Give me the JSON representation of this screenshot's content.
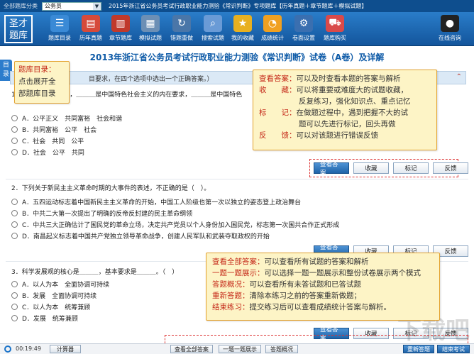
{
  "topbar": {
    "bank_label": "全部题库分类",
    "bank_value": "公务员",
    "title": "2015年浙江省公务员考试行政职业能力测验《常识判断》专项题库【历年真题＋章节题库＋模拟试题】"
  },
  "logo": {
    "line1": "圣才",
    "line2": "题库"
  },
  "toolbar": [
    {
      "label": "题库目录",
      "icon": "list-icon",
      "color": "#3a8ad6"
    },
    {
      "label": "历年真题",
      "icon": "book-icon",
      "color": "#d64a3a"
    },
    {
      "label": "章节题库",
      "icon": "book-stack-icon",
      "color": "#c0392b"
    },
    {
      "label": "模拟试题",
      "icon": "document-icon",
      "color": "#6c8fb5"
    },
    {
      "label": "错题重做",
      "icon": "redo-icon",
      "color": "#4a76a8"
    },
    {
      "label": "搜索试题",
      "icon": "search-icon",
      "color": "#6a9bd6"
    },
    {
      "label": "我的收藏",
      "icon": "star-icon",
      "color": "#e8b020"
    },
    {
      "label": "成绩统计",
      "icon": "chart-icon",
      "color": "#f0a020"
    },
    {
      "label": "卷面设置",
      "icon": "gear-icon",
      "color": "#3a6fb0"
    },
    {
      "label": "题库购买",
      "icon": "cart-icon",
      "color": "#d94a4a"
    },
    {
      "label": "在线咨询",
      "icon": "qq-icon",
      "color": "#222222"
    }
  ],
  "page_title": "2013年浙江省公务员考试行政职业能力测验《常识判断》试卷（A卷）及详解",
  "dir_tab": "目录",
  "instruction": "目要求，在四个选项中选出一个正确答案。）",
  "questions": [
    {
      "stem": "1．　　　　　　　出，＿＿＿是中国特色社会主义的内在要求，＿＿＿是中国特色",
      "options": [
        "A．公平正义　共同富裕　社会和谐",
        "B．共同富裕　公平　社会",
        "C．社会　共同　公平",
        "D．社会　公平　共同"
      ]
    },
    {
      "stem": "2．下列关于新民主主义革命时期的大事件的表述，不正确的是（　）。",
      "options": [
        "A．五四运动标志着中国新民主主义革命的开始，中国工人阶级也第一次以独立的姿态登上政治舞台",
        "B．中共二大第一次提出了明确的反帝反封建的民主革命纲领",
        "C．中共三大正确估计了国民党的革命立场，决定共产党员以个人身份加入国民党，标志第一次国共合作正式形成",
        "D．南昌起义标志着中国共产党独立领导革命战争，创建人民军队和武装夺取政权的开始"
      ]
    },
    {
      "stem": "3．科学发展观的核心是＿＿＿，基本要求是＿＿＿。（　）",
      "options": [
        "A．以人为本　全面协调可持续",
        "B．发展　全面协调可持续",
        "C．以人为本　统筹兼顾",
        "D．发展　统筹兼顾"
      ]
    }
  ],
  "question_buttons": [
    "查看答案",
    "收藏",
    "标记",
    "反馈"
  ],
  "callouts": {
    "catalog": [
      "题库目录：",
      "点击展开全",
      "部题库目录"
    ],
    "question_tools": [
      {
        "key": "查看答案：",
        "text": "可以及时查看本题的答案与解析"
      },
      {
        "key": "收　　藏：",
        "text": "可以将重要或难度大的试题收藏，"
      },
      {
        "key": "",
        "text": "反复练习，强化知识点、重点记忆"
      },
      {
        "key": "标　　记：",
        "text": "在做题过程中，遇到把握不大的试"
      },
      {
        "key": "",
        "text": "题可以先进行标记，回头再做"
      },
      {
        "key": "反　　馈：",
        "text": "可以对该题进行错误反馈"
      }
    ],
    "bottom_tools": [
      {
        "key": "查看全部答案：",
        "text": "可以查看所有试题的答案和解析"
      },
      {
        "key": "一题一题展示：",
        "text": "可以选择一题一题展示和整份试卷展示两个模式"
      },
      {
        "key": "答题概况：",
        "text": "可以查看所有未答试题和已答试题"
      },
      {
        "key": "重新答题：",
        "text": "清除本练习之前的答案重新做题；"
      },
      {
        "key": "结束练习：",
        "text": "提交练习后可以查看成绩统计答案与解析。"
      }
    ]
  },
  "bottom": {
    "timer": "00:19:49",
    "calculator": "计算器",
    "view_all": "查看全部答案",
    "one_by_one": "一题一题展示",
    "overview": "答题概况",
    "restart": "重新答题",
    "finish": "结束考试"
  },
  "watermark": "下载吧"
}
